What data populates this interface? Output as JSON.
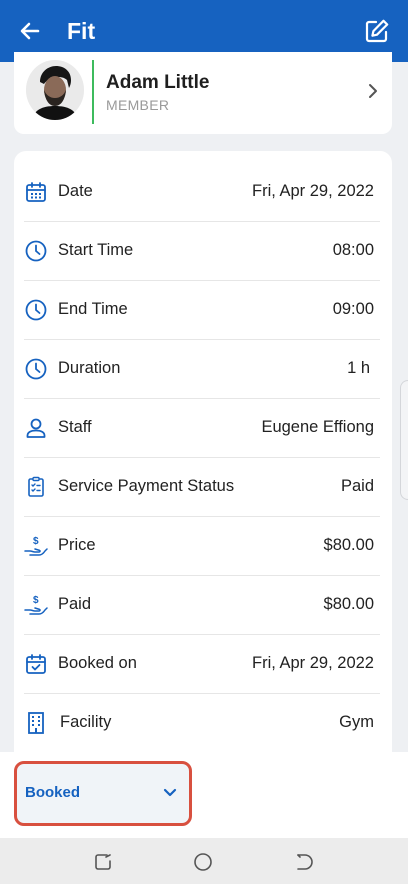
{
  "appbar": {
    "title": "Fit",
    "back_icon": "arrow-left-icon",
    "edit_icon": "edit-icon",
    "color": "#1662c0"
  },
  "member": {
    "name": "Adam Little",
    "role": "MEMBER"
  },
  "details": [
    {
      "icon": "calendar-icon",
      "label": "Date",
      "value": "Fri, Apr 29, 2022"
    },
    {
      "icon": "clock-icon",
      "label": "Start Time",
      "value": "08:00"
    },
    {
      "icon": "clock-icon",
      "label": "End Time",
      "value": "09:00"
    },
    {
      "icon": "clock-icon",
      "label": "Duration",
      "value": "1 h"
    },
    {
      "icon": "user-icon",
      "label": "Staff",
      "value": "Eugene Effiong"
    },
    {
      "icon": "clipboard-icon",
      "label": "Service Payment Status",
      "value": "Paid"
    },
    {
      "icon": "hand-dollar-icon",
      "label": "Price",
      "value": "$80.00"
    },
    {
      "icon": "hand-dollar-icon",
      "label": "Paid",
      "value": "$80.00"
    },
    {
      "icon": "calendar-check-icon",
      "label": "Booked on",
      "value": "Fri, Apr 29, 2022"
    },
    {
      "icon": "building-icon",
      "label": "Facility",
      "value": "Gym"
    }
  ],
  "status": {
    "selected": "Booked",
    "highlight_color": "#d8503f"
  },
  "navbar": {
    "icons": [
      "recent-apps-icon",
      "home-icon",
      "back-nav-icon"
    ]
  }
}
